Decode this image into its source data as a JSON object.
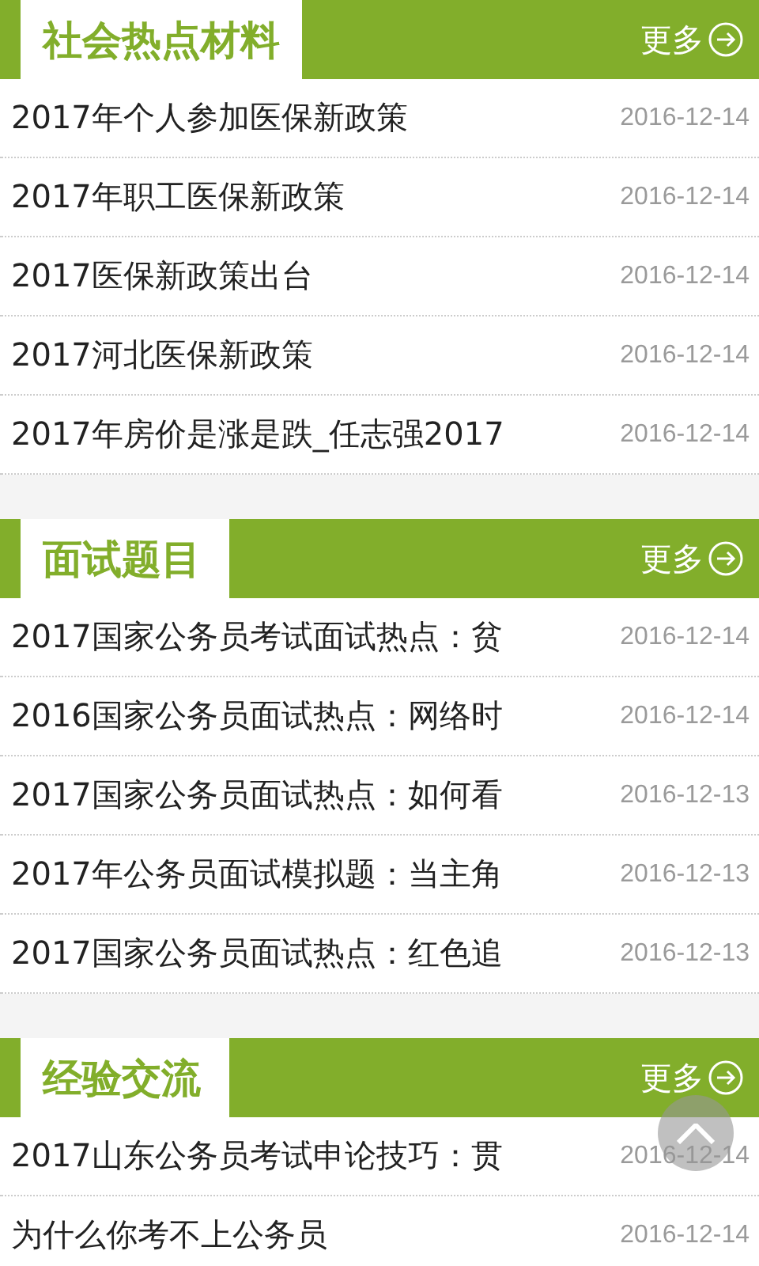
{
  "sections": [
    {
      "title": "社会热点材料",
      "more": "更多",
      "rows": [
        {
          "title": "2017年个人参加医保新政策",
          "date": "2016-12-14"
        },
        {
          "title": "2017年职工医保新政策",
          "date": "2016-12-14"
        },
        {
          "title": "2017医保新政策出台",
          "date": "2016-12-14"
        },
        {
          "title": "2017河北医保新政策",
          "date": "2016-12-14"
        },
        {
          "title": "2017年房价是涨是跌_任志强2017",
          "date": "2016-12-14"
        }
      ]
    },
    {
      "title": "面试题目",
      "more": "更多",
      "rows": [
        {
          "title": "2017国家公务员考试面试热点：贫",
          "date": "2016-12-14"
        },
        {
          "title": "2016国家公务员面试热点：网络时",
          "date": "2016-12-14"
        },
        {
          "title": "2017国家公务员面试热点：如何看",
          "date": "2016-12-13"
        },
        {
          "title": "2017年公务员面试模拟题：当主角",
          "date": "2016-12-13"
        },
        {
          "title": "2017国家公务员面试热点：红色追",
          "date": "2016-12-13"
        }
      ]
    },
    {
      "title": "经验交流",
      "more": "更多",
      "rows": [
        {
          "title": "2017山东公务员考试申论技巧：贯",
          "date": "2016-12-14"
        },
        {
          "title": "为什么你考不上公务员",
          "date": "2016-12-14"
        }
      ]
    }
  ]
}
